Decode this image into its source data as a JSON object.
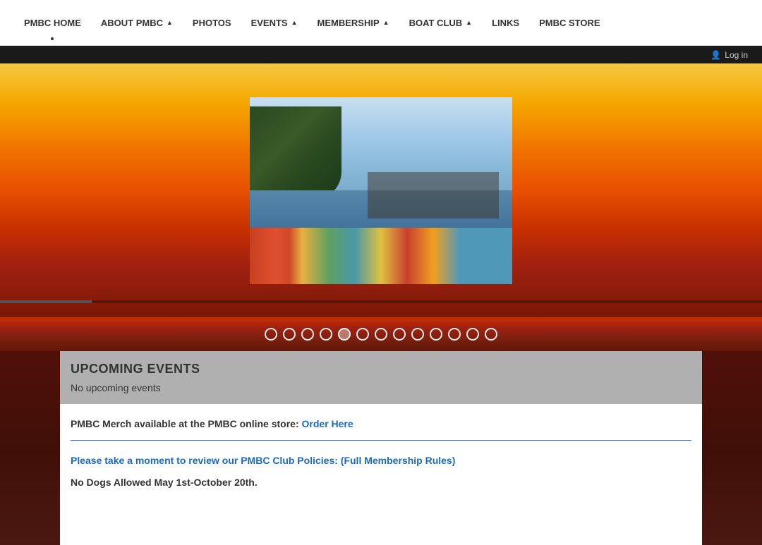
{
  "nav": {
    "items": [
      {
        "label": "PMBC HOME",
        "has_dot": true,
        "has_chevron": false
      },
      {
        "label": "ABOUT PMBC",
        "has_dot": false,
        "has_chevron": true
      },
      {
        "label": "PHOTOS",
        "has_dot": false,
        "has_chevron": false
      },
      {
        "label": "EVENTS",
        "has_dot": false,
        "has_chevron": true
      },
      {
        "label": "MEMBERSHIP",
        "has_dot": false,
        "has_chevron": true
      },
      {
        "label": "BOAT CLUB",
        "has_dot": false,
        "has_chevron": true
      },
      {
        "label": "LINKS",
        "has_dot": false,
        "has_chevron": false
      },
      {
        "label": "PMBC STORE",
        "has_dot": false,
        "has_chevron": false
      }
    ]
  },
  "header": {
    "log_in_label": "Log in",
    "person_icon": "👤"
  },
  "carousel": {
    "dots_count": 13,
    "active_dot": 4
  },
  "upcoming_events": {
    "title": "UPCOMING EVENTS",
    "no_events_text": "No upcoming events"
  },
  "content": {
    "merch_text": "PMBC Merch available at the PMBC online store:",
    "merch_link_label": "Order Here",
    "policy_text": "Please take a moment to review our PMBC Club Policies:",
    "policy_prefix": "  (",
    "policy_link_label": "Full Membership Rules",
    "policy_suffix": ")",
    "no_dogs_text": "No Dogs Allowed May 1st-October 20th."
  }
}
